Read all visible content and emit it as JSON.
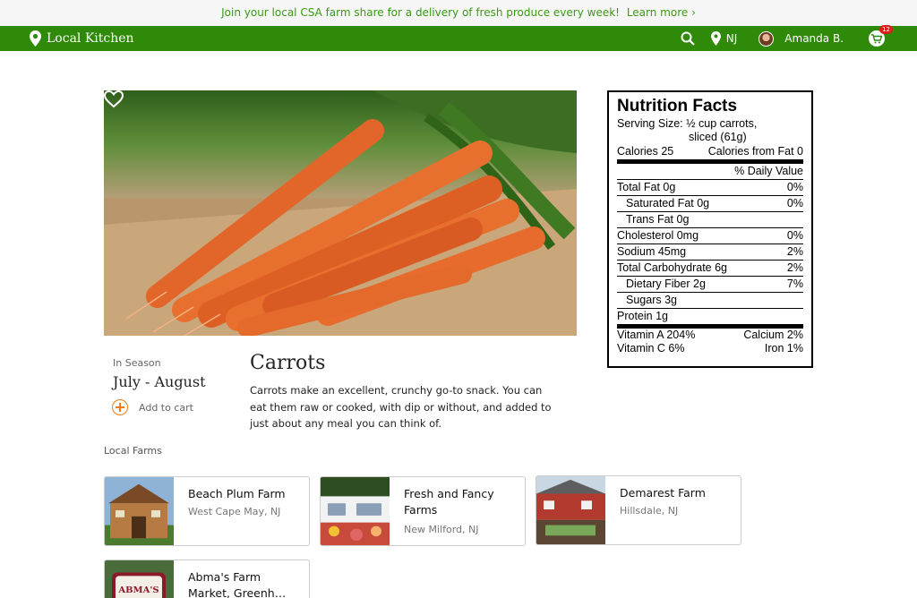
{
  "promo": {
    "text": "Join your local CSA farm share for a delivery of fresh produce every week!",
    "link": "Learn more ›"
  },
  "nav": {
    "brand": "Local Kitchen",
    "location": "NJ",
    "user": "Amanda B.",
    "cart_count": "12"
  },
  "product": {
    "title": "Carrots",
    "description": "Carrots make an excellent, crunchy go-to snack. You can eat them raw or cooked, with dip or without, and added to just about any meal you can think of.",
    "season_label": "In Season",
    "season_value": "July - August",
    "add_to_cart": "Add to cart"
  },
  "nutrition": {
    "title": "Nutrition Facts",
    "serving_line1": "Serving Size: ½ cup carrots,",
    "serving_line2": "sliced (61g)",
    "calories": "Calories 25",
    "calories_fat": "Calories from Fat 0",
    "daily_value": "% Daily Value",
    "rows": [
      {
        "label": "Total Fat 0g",
        "value": "0%"
      },
      {
        "label": "Saturated Fat 0g",
        "value": "0%"
      },
      {
        "label": "Trans Fat 0g",
        "value": ""
      },
      {
        "label": "Cholesterol 0mg",
        "value": "0%"
      },
      {
        "label": "Sodium 45mg",
        "value": "2%"
      },
      {
        "label": "Total Carbohydrate 6g",
        "value": "2%"
      },
      {
        "label": "Dietary Fiber 2g",
        "value": "7%"
      },
      {
        "label": "Sugars 3g",
        "value": ""
      },
      {
        "label": "Protein 1g",
        "value": ""
      }
    ],
    "vitamins": [
      {
        "left": "Vitamin A 204%",
        "right": "Calcium 2%"
      },
      {
        "left": "Vitamin C 6%",
        "right": "Iron 1%"
      }
    ]
  },
  "farms": {
    "label": "Local Farms",
    "items": [
      {
        "name": "Beach Plum Farm",
        "location": "West Cape May, NJ"
      },
      {
        "name": "Fresh and Fancy Farms",
        "location": "New Milford, NJ"
      },
      {
        "name": "Demarest Farm",
        "location": "Hillsdale, NJ"
      },
      {
        "name": "Abma's Farm Market, Greenh…",
        "location": "",
        "sign": "ABMA'S"
      }
    ]
  }
}
